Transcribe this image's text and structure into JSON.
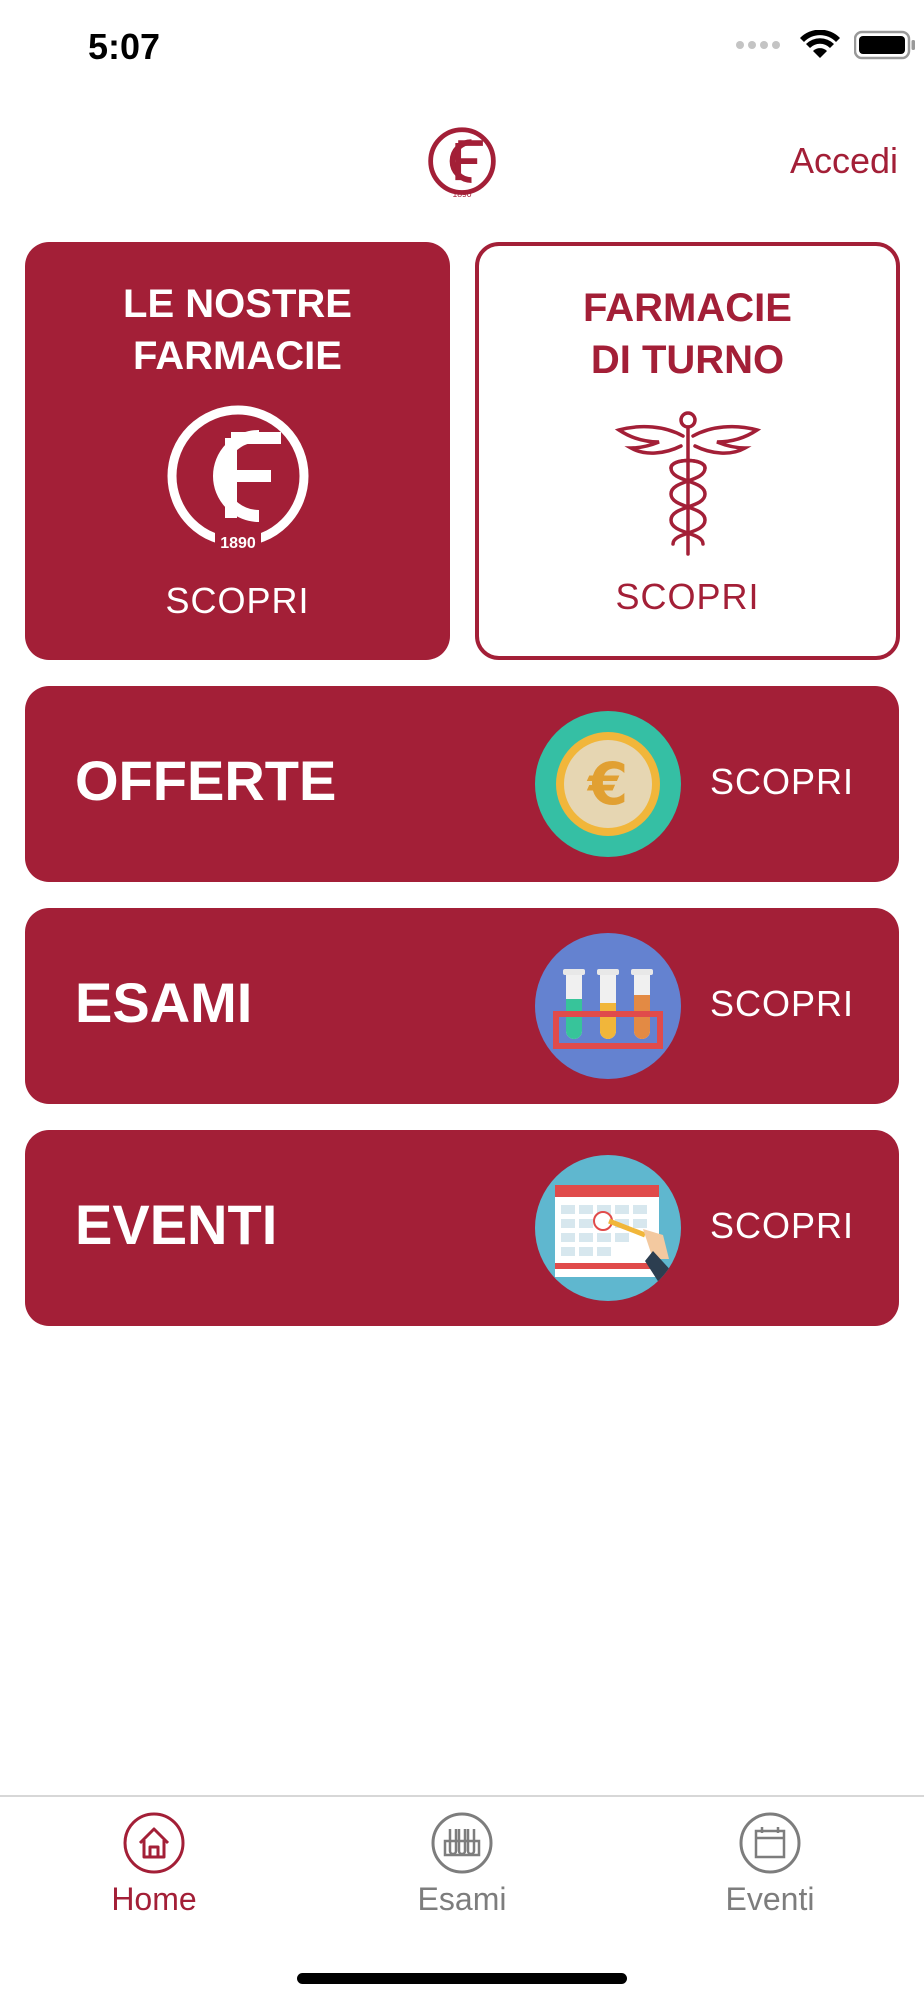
{
  "status_bar": {
    "time": "5:07"
  },
  "header": {
    "login_label": "Accedi"
  },
  "tiles": [
    {
      "title": "LE NOSTRE\nFARMACIE",
      "cta": "SCOPRI",
      "icon": "pharmacy-logo-icon",
      "logo_year": "1890"
    },
    {
      "title": "FARMACIE\nDI TURNO",
      "cta": "SCOPRI",
      "icon": "caduceus-icon"
    }
  ],
  "rows": [
    {
      "title": "OFFERTE",
      "cta": "SCOPRI",
      "icon": "euro-coin-icon"
    },
    {
      "title": "ESAMI",
      "cta": "SCOPRI",
      "icon": "test-tubes-icon"
    },
    {
      "title": "EVENTI",
      "cta": "SCOPRI",
      "icon": "calendar-icon"
    }
  ],
  "tab_bar": {
    "items": [
      {
        "label": "Home",
        "icon": "home-icon",
        "active": true
      },
      {
        "label": "Esami",
        "icon": "test-tubes-icon",
        "active": false
      },
      {
        "label": "Eventi",
        "icon": "calendar-icon",
        "active": false
      }
    ]
  },
  "colors": {
    "brand": "#a31f37",
    "inactive": "#7d7d7d",
    "coin_ring": "#35bfa4",
    "tubes_bg": "#6482d0",
    "calendar_bg": "#5fb7cf"
  }
}
